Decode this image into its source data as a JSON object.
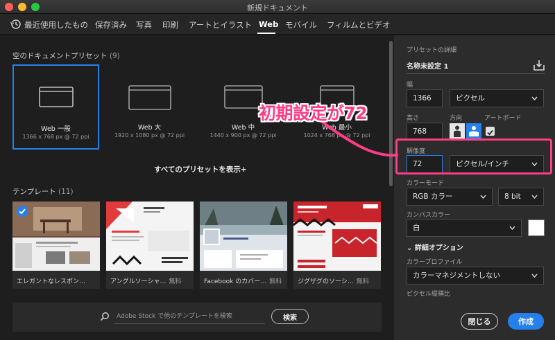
{
  "window": {
    "title": "新規ドキュメント"
  },
  "tabs": [
    {
      "label": "最近使用したもの"
    },
    {
      "label": "保存済み"
    },
    {
      "label": "写真"
    },
    {
      "label": "印刷"
    },
    {
      "label": "アートとイラスト"
    },
    {
      "label": "Web"
    },
    {
      "label": "モバイル"
    },
    {
      "label": "フィルムとビデオ"
    }
  ],
  "active_tab": "Web",
  "blank_presets": {
    "title": "空のドキュメントプリセット",
    "count": "(9)",
    "items": [
      {
        "name": "Web 一般",
        "size": "1366 x 768 px @ 72 ppi",
        "selected": true
      },
      {
        "name": "Web 大",
        "size": "1920 x 1080 px @ 72 ppi"
      },
      {
        "name": "Web 中",
        "size": "1440 x 900 px @ 72 ppi"
      },
      {
        "name": "Web 最小",
        "size": "1024 x 768 px @ 72 ppi"
      }
    ],
    "show_all_label": "すべてのプリセットを表示+"
  },
  "templates": {
    "title": "テンプレート",
    "count": "(11)",
    "items": [
      {
        "label": "エレガントなレスポン…",
        "badge": ""
      },
      {
        "label": "アングルソーシャ…",
        "badge": "無料"
      },
      {
        "label": "Facebook のカバー…",
        "badge": "無料"
      },
      {
        "label": "ジグザグのソーシ…",
        "badge": "無料"
      }
    ]
  },
  "stock": {
    "placeholder": "Adobe Stock で他のテンプレートを検索",
    "search_label": "検索"
  },
  "preset_details": {
    "header": "プリセットの詳細",
    "name": "名称未設定 1",
    "width_label": "幅",
    "width_value": "1366",
    "width_unit": "ピクセル",
    "height_label": "高さ",
    "height_value": "768",
    "orientation_label": "方向",
    "artboard_label": "アートボード",
    "resolution_label": "解像度",
    "resolution_value": "72",
    "resolution_unit": "ピクセル/インチ",
    "color_mode_label": "カラーモード",
    "color_mode": "RGB カラー",
    "bit_depth": "8 bit",
    "canvas_color_label": "カンバスカラー",
    "canvas_color": "白",
    "advanced_label": "詳細オプション",
    "color_profile_label": "カラープロファイル",
    "color_profile": "カラーマネジメントしない",
    "pixel_aspect_label": "ピクセル縦横比"
  },
  "buttons": {
    "close": "閉じる",
    "create": "作成"
  },
  "annotation": {
    "text": "初期設定が72"
  },
  "colors": {
    "accent": "#2680eb",
    "annotation": "#ff3d86"
  }
}
